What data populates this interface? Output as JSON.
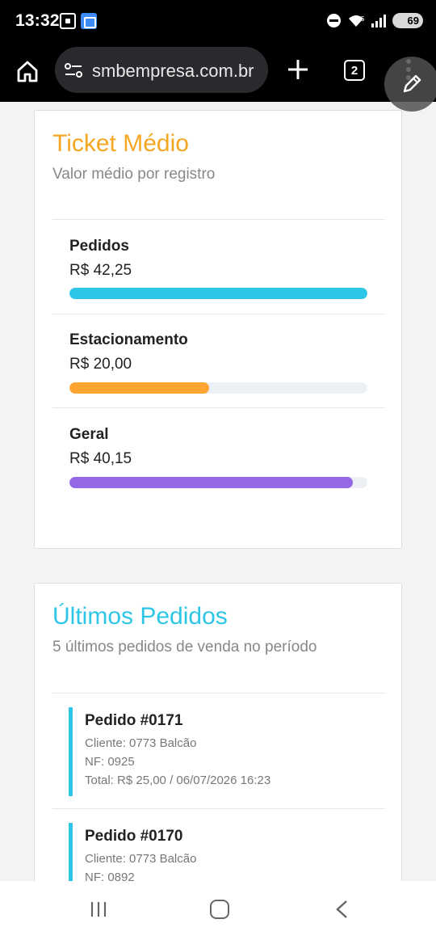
{
  "status_bar": {
    "time": "13:32",
    "battery": "69",
    "icons": [
      "screenshot-icon",
      "gallery-icon",
      "do-not-disturb-icon",
      "wifi-icon",
      "signal-icon",
      "battery-icon"
    ]
  },
  "browser": {
    "url": "smbempresa.com.br",
    "tab_count": "2",
    "icons": [
      "home-icon",
      "site-settings-icon",
      "new-tab-plus-icon",
      "tabs-icon",
      "more-menu-icon",
      "edit-pencil-icon"
    ]
  },
  "ticket_card": {
    "title": "Ticket Médio",
    "subtitle": "Valor médio por registro",
    "metrics": [
      {
        "label": "Pedidos",
        "value": "R$ 42,25",
        "percent": 100,
        "color": "#2ec6e6"
      },
      {
        "label": "Estacionamento",
        "value": "R$ 20,00",
        "percent": 47,
        "color": "#ffa534"
      },
      {
        "label": "Geral",
        "value": "R$ 40,15",
        "percent": 95,
        "color": "#9467e6"
      }
    ]
  },
  "orders_card": {
    "title": "Últimos Pedidos",
    "subtitle": "5 últimos pedidos de venda no período",
    "orders": [
      {
        "title": "Pedido #0171",
        "client": "Cliente: 0773 Balcão",
        "nf": "NF: 0925",
        "total": "Total: R$ 25,00 / 06/07/2026 16:23"
      },
      {
        "title": "Pedido #0170",
        "client": "Cliente: 0773 Balcão",
        "nf": "NF: 0892"
      }
    ]
  },
  "nav_bar": {
    "icons": [
      "recent-apps-icon",
      "home-button-icon",
      "back-icon"
    ]
  },
  "colors": {
    "accent_orange": "#f5a623",
    "accent_cyan": "#2ec6e6",
    "accent_purple": "#9467e6"
  }
}
